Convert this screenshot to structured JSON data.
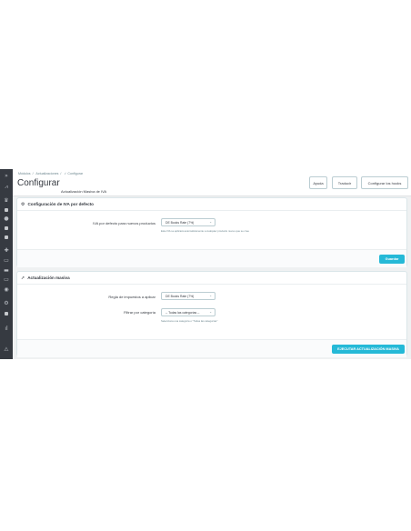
{
  "breadcrumb": [
    "Módulos",
    "Actualizaciones",
    "✓ Configurar"
  ],
  "header": {
    "title": "Configurar",
    "subtitle": "Actualización Masiva de IVA",
    "buttons": {
      "help": "Ayuda",
      "translate": "Traducir",
      "configure_hooks": "Configurar los hooks"
    }
  },
  "sidebar": {
    "icons": [
      "expand-icon",
      "stats-icon",
      "shop-icon",
      "orders-icon",
      "customers-icon",
      "catalog-icon",
      "sales-icon",
      "modules-icon",
      "design-icon",
      "shipping-icon",
      "payment-icon",
      "international-icon",
      "parameters-icon",
      "advanced-icon",
      "stats-bottom-icon",
      "help-icon"
    ]
  },
  "default_vat": {
    "title": "Configuración de IVA por defecto",
    "label": "IVA por defecto para nuevos productos",
    "select_value": "DE Books Rate (7%)",
    "help": "Este IVA se aplicará automáticamente a cualquier producto nuevo que se cree",
    "save": "Guardar"
  },
  "bulk_update": {
    "title": "Actualización masiva",
    "tax_rule_label": "Regla de impuestos a aplicar",
    "tax_rule_value": "DE Books Rate (7%)",
    "category_label": "Filtrar por categoría",
    "category_value": "-- Todas las categorías --",
    "category_help": "Selecciona una categoría o \"Todas las categorías\"",
    "run": "EJECUTAR ACTUALIZACIÓN MASIVA"
  }
}
